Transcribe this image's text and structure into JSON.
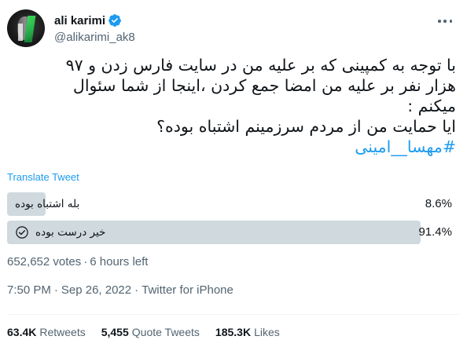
{
  "author": {
    "name": "ali karimi",
    "handle": "@alikarimi_ak8",
    "verified": true,
    "avatar_icon": "profile-photo"
  },
  "tweet": {
    "lines": [
      "با توجه به کمپینی که بر علیه من در سایت فارس زدن و ۹۷",
      "هزار نفر بر علیه من امضا جمع کردن ،اینجا از شما سئوال",
      "میکنم :",
      "ایا حمایت من از مردم سرزمینم اشتباه بوده؟"
    ],
    "hashtag": "#مهسا__امینی"
  },
  "translate_label": "Translate Tweet",
  "poll": {
    "options": [
      {
        "label": "بله اشتباه بوده",
        "percent_text": "8.6%",
        "percent": 8.6,
        "winner": false
      },
      {
        "label": "خیر درست بوده",
        "percent_text": "91.4%",
        "percent": 91.4,
        "winner": true
      }
    ],
    "votes": "652,652 votes",
    "time_left": "6 hours left"
  },
  "meta": {
    "time": "7:50 PM",
    "date": "Sep 26, 2022",
    "source": "Twitter for iPhone"
  },
  "stats": {
    "retweets_count": "63.4K",
    "retweets_label": "Retweets",
    "quotes_count": "5,455",
    "quotes_label": "Quote Tweets",
    "likes_count": "185.3K",
    "likes_label": "Likes"
  },
  "colors": {
    "accent": "#1d9bf0",
    "poll_bar": "#cfd9de",
    "secondary_text": "#536471"
  }
}
